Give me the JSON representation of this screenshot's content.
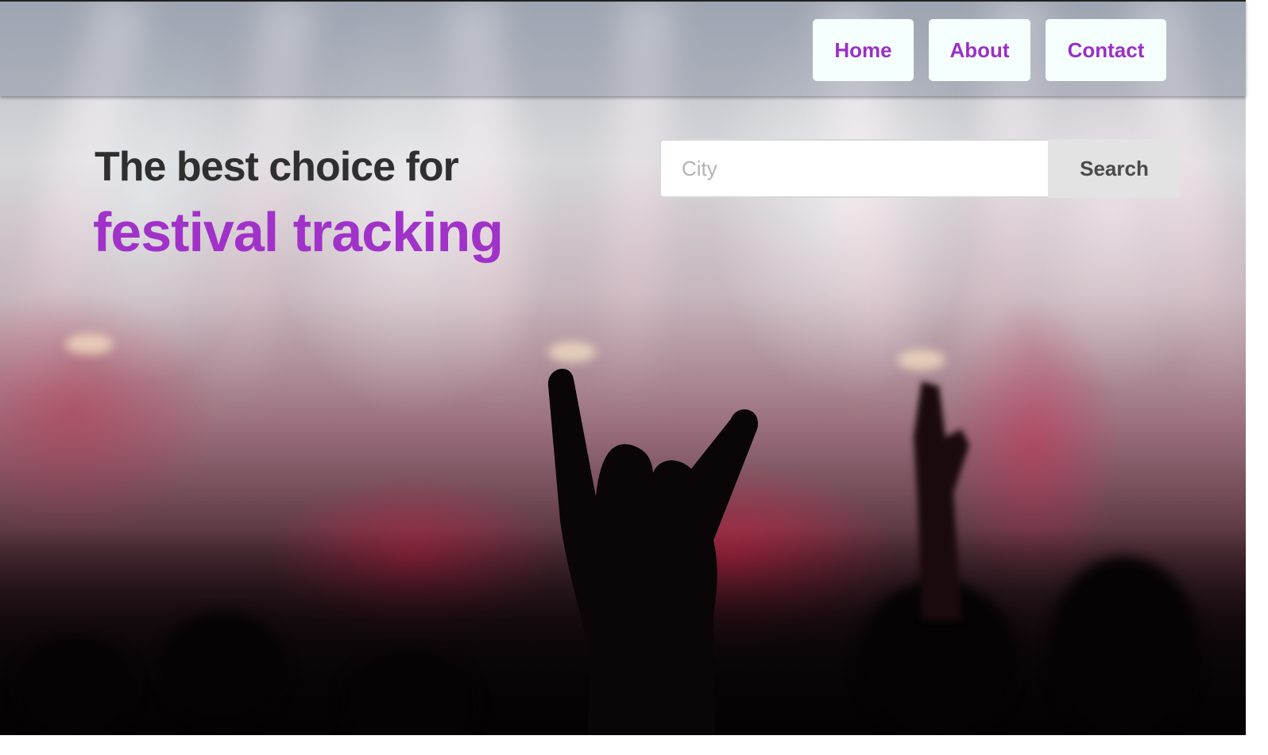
{
  "nav": {
    "home_label": "Home",
    "about_label": "About",
    "contact_label": "Contact"
  },
  "hero": {
    "title_line1": "The best choice for",
    "title_line2": "festival tracking",
    "background_image": "concert-crowd-photo"
  },
  "search": {
    "placeholder": "City",
    "value": "",
    "button_label": "Search"
  },
  "colors": {
    "accent": "#a132c9",
    "nav_button_bg": "#f4fffe",
    "title_dark": "#2f2f2f",
    "search_button_bg": "#e3e3e3"
  }
}
